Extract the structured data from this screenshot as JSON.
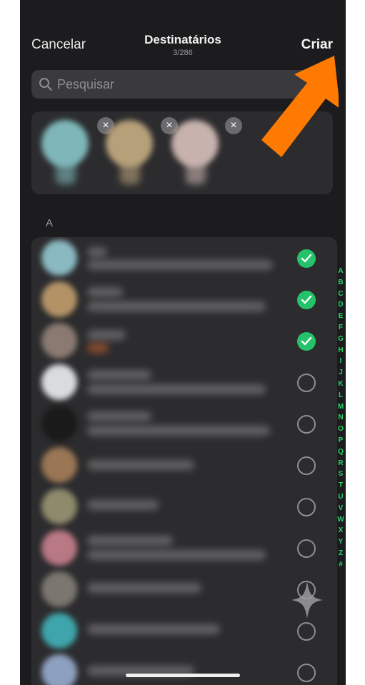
{
  "header": {
    "cancel_label": "Cancelar",
    "title": "Destinatários",
    "subtitle": "3/286",
    "create_label": "Criar"
  },
  "search": {
    "placeholder": "Pesquisar",
    "icon": "search-icon"
  },
  "selected": [
    {
      "avatar_color": "#7fb7b9",
      "remove_label": "×"
    },
    {
      "avatar_color": "#b6a07a",
      "remove_label": "×"
    },
    {
      "avatar_color": "#c7b2ad",
      "remove_label": "×"
    }
  ],
  "section_letter": "A",
  "contacts": [
    {
      "avatar_color": "#8ab9c2",
      "selected": true
    },
    {
      "avatar_color": "#b39366",
      "selected": true
    },
    {
      "avatar_color": "#8a7a72",
      "selected": true
    },
    {
      "avatar_color": "#d9dcde",
      "selected": false
    },
    {
      "avatar_color": "#1a1a1a",
      "selected": false
    },
    {
      "avatar_color": "#9a7654",
      "selected": false
    },
    {
      "avatar_color": "#8e8a6c",
      "selected": false
    },
    {
      "avatar_color": "#b87884",
      "selected": false
    },
    {
      "avatar_color": "#7c7670",
      "selected": false
    },
    {
      "avatar_color": "#3fa5ac",
      "selected": false
    },
    {
      "avatar_color": "#8ea0c0",
      "selected": false
    }
  ],
  "alphabet_index": [
    "A",
    "B",
    "C",
    "D",
    "E",
    "F",
    "G",
    "H",
    "I",
    "J",
    "K",
    "L",
    "M",
    "N",
    "O",
    "P",
    "Q",
    "R",
    "S",
    "T",
    "U",
    "V",
    "W",
    "X",
    "Y",
    "Z",
    "#"
  ],
  "colors": {
    "background": "#1c1c1e",
    "panel": "#2c2c2e",
    "accent_green": "#25c26b",
    "annotation_arrow": "#ff7a00"
  },
  "annotation": {
    "icon": "orange-arrow-icon"
  }
}
